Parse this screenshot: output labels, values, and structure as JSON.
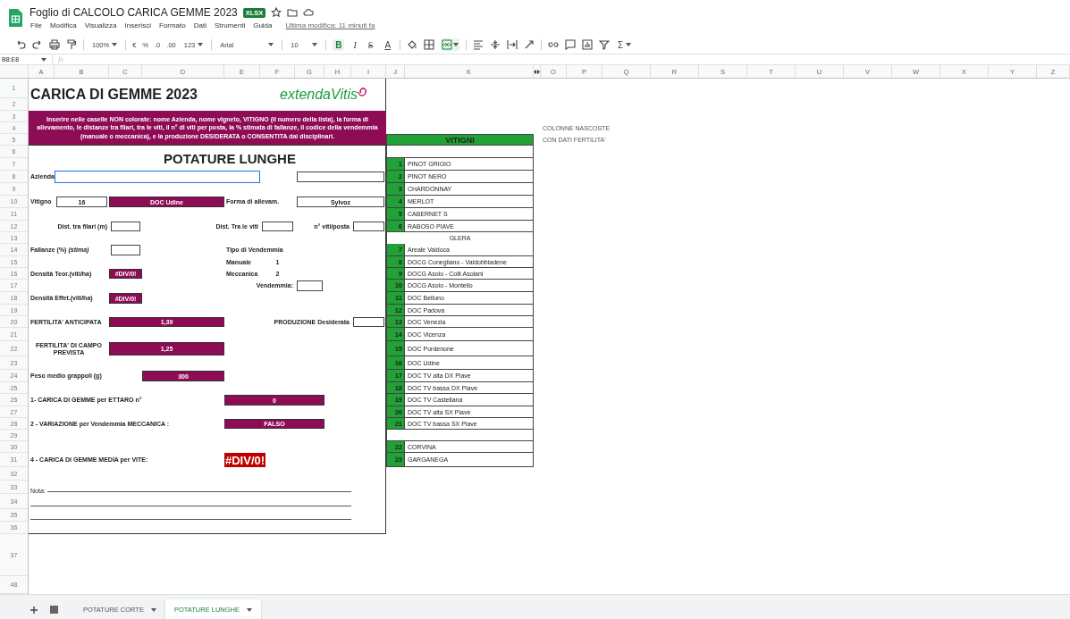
{
  "document": {
    "title": "Foglio di CALCOLO CARICA GEMME 2023",
    "badge": "XLSX",
    "last_edit": "Ultima modifica: 11 minuti fa"
  },
  "menu": [
    "File",
    "Modifica",
    "Visualizza",
    "Inserisci",
    "Formato",
    "Dati",
    "Strumenti",
    "Guida"
  ],
  "toolbar": {
    "zoom": "100%",
    "number_formats": [
      "€",
      "%",
      ".0",
      ".00"
    ],
    "more_formats": "123",
    "font": "Arial",
    "font_size": "10",
    "text_styles": [
      {
        "label": "B",
        "active": true
      },
      {
        "label": "I",
        "active": false
      },
      {
        "label": "S",
        "active": false
      },
      {
        "label": "A",
        "active": false
      }
    ],
    "merge_active": true,
    "function": "Σ"
  },
  "formula_bar": {
    "cell_ref": "B8:E8",
    "fx": "fx"
  },
  "columns": [
    "A",
    "B",
    "C",
    "D",
    "E",
    "F",
    "G",
    "H",
    "I",
    "J",
    "K",
    "O",
    "P",
    "Q",
    "R",
    "S",
    "T",
    "U",
    "V",
    "W",
    "X",
    "Y",
    "Z"
  ],
  "rows": [
    "1",
    "2",
    "3",
    "4",
    "5",
    "6",
    "7",
    "8",
    "9",
    "10",
    "11",
    "12",
    "13",
    "14",
    "15",
    "16",
    "17",
    "18",
    "19",
    "20",
    "21",
    "22",
    "23",
    "24",
    "25",
    "26",
    "27",
    "28",
    "29",
    "30",
    "31",
    "32",
    "33",
    "34",
    "35",
    "36",
    "37",
    "48"
  ],
  "form": [
    {
      "kind": "title",
      "text": "CARICA DI GEMME 2023"
    },
    {
      "kind": "logo",
      "text": "extendaVitis"
    },
    {
      "kind": "banner",
      "text": "Inserire nelle caselle NON colorate: nome Azienda, nome vigneto, VITIGNO (il numero della lista), la forma di allevamento, le distanze tra filari, tra le viti, il n° di viti per posta, la % stimata di fallanze, il codice della vendemmia (manuale o meccanica),  e la produzione DESIDERATA o CONSENTITA dai disciplinari."
    },
    {
      "kind": "heading",
      "text": "POTATURE LUNGHE"
    },
    {
      "kind": "label",
      "text": "Azienda"
    },
    {
      "kind": "input",
      "selected": true
    },
    {
      "kind": "input",
      "selected": false
    },
    {
      "kind": "label",
      "text": "Vitigno"
    },
    {
      "kind": "input",
      "value": "16",
      "selected": false
    },
    {
      "kind": "value",
      "text": "DOC Udine"
    },
    {
      "kind": "label",
      "text": "Forma di allevam."
    },
    {
      "kind": "input",
      "value": "Sylvoz",
      "selected": false
    },
    {
      "kind": "label",
      "text": "Dist. tra filari (m)"
    },
    {
      "kind": "input",
      "selected": false
    },
    {
      "kind": "label",
      "text": "Dist. Tra le viti"
    },
    {
      "kind": "input",
      "selected": false
    },
    {
      "kind": "label",
      "text": "n° viti/posta"
    },
    {
      "kind": "input",
      "selected": false
    },
    {
      "kind": "label",
      "text": "Fallanze (%) *(stima)*"
    },
    {
      "kind": "input",
      "selected": false
    },
    {
      "kind": "label",
      "text": "Tipo di Vendemmia"
    },
    {
      "kind": "label",
      "text": "Manuale"
    },
    {
      "kind": "label",
      "text": "1"
    },
    {
      "kind": "label",
      "text": "Densità Teor.(viti/ha)"
    },
    {
      "kind": "value",
      "text": "#DIV/0!"
    },
    {
      "kind": "label",
      "text": "Meccanica"
    },
    {
      "kind": "label",
      "text": "2"
    },
    {
      "kind": "label",
      "text": "Vendemmia:"
    },
    {
      "kind": "input",
      "selected": false
    },
    {
      "kind": "label",
      "text": "Densità Effet.(viti/ha)"
    },
    {
      "kind": "value",
      "text": "#DIV/0!"
    },
    {
      "kind": "label",
      "text": "FERTILITA' ANTICIPATA"
    },
    {
      "kind": "value",
      "text": "1,39"
    },
    {
      "kind": "label",
      "text": "PRODUZIONE Desiderata"
    },
    {
      "kind": "input",
      "selected": false
    },
    {
      "kind": "label",
      "text": "FERTILITA' DI CAMPO PREVISTA"
    },
    {
      "kind": "value",
      "text": "1,25"
    },
    {
      "kind": "label",
      "text": "Peso medio grappoli (g)"
    },
    {
      "kind": "value",
      "text": "300"
    },
    {
      "kind": "label",
      "text": "1- CARICA DI GEMME  per  ETTARO n°"
    },
    {
      "kind": "value",
      "text": "0"
    },
    {
      "kind": "label",
      "text": "2 - VARIAZIONE per Vendemmia MECCANICA :"
    },
    {
      "kind": "value",
      "text": "FALSO"
    },
    {
      "kind": "label",
      "text": "4 - CARICA DI GEMME MEDIA per VITE:"
    },
    {
      "kind": "error",
      "text": "#DIV/0!"
    },
    {
      "kind": "note",
      "text": "Nota:"
    }
  ],
  "side_note": [
    "COLONNE NASCOSTE",
    "CON DATI FERTILITA'"
  ],
  "vitigni": {
    "title": "VITIGNI",
    "items": [
      {
        "kind": "spacer"
      },
      {
        "kind": "variety",
        "number": "1",
        "name": "PINOT GRIGIO"
      },
      {
        "kind": "variety",
        "number": "2",
        "name": "PINOT NERO"
      },
      {
        "kind": "variety",
        "number": "3",
        "name": "CHARDONNAY"
      },
      {
        "kind": "variety",
        "number": "4",
        "name": "MERLOT"
      },
      {
        "kind": "variety",
        "number": "5",
        "name": "CABERNET S"
      },
      {
        "kind": "variety",
        "number": "6",
        "name": "RABOSO PIAVE"
      },
      {
        "kind": "group",
        "name": "GLERA"
      },
      {
        "kind": "variety",
        "number": "7",
        "name": "Areale Valdoca"
      },
      {
        "kind": "variety",
        "number": "8",
        "name": "DOCG Conegliano - Valdobbiadene"
      },
      {
        "kind": "variety",
        "number": "9",
        "name": "DOCG Asolo - Colli Asolani"
      },
      {
        "kind": "variety",
        "number": "10",
        "name": "DOCG Asolo - Montello"
      },
      {
        "kind": "variety",
        "number": "11",
        "name": "DOC Belluno"
      },
      {
        "kind": "variety",
        "number": "12",
        "name": "DOC Padova"
      },
      {
        "kind": "variety",
        "number": "13",
        "name": "DOC Venezia"
      },
      {
        "kind": "variety",
        "number": "14",
        "name": "DOC Vicenza"
      },
      {
        "kind": "variety",
        "number": "15",
        "name": "DOC Pordenone"
      },
      {
        "kind": "variety",
        "number": "16",
        "name": "DOC Udine"
      },
      {
        "kind": "variety",
        "number": "17",
        "name": "DOC TV alta DX Piave"
      },
      {
        "kind": "variety",
        "number": "18",
        "name": "DOC TV bassa DX Piave"
      },
      {
        "kind": "variety",
        "number": "19",
        "name": "DOC TV Castellana"
      },
      {
        "kind": "variety",
        "number": "20",
        "name": "DOC TV alta SX Piave"
      },
      {
        "kind": "variety",
        "number": "21",
        "name": "DOC TV bassa SX Piave"
      },
      {
        "kind": "spacer"
      },
      {
        "kind": "variety",
        "number": "22",
        "name": "CORVINA"
      },
      {
        "kind": "variety",
        "number": "23",
        "name": "GARGANEGA"
      }
    ]
  },
  "tabs": [
    {
      "label": "POTATURE CORTE",
      "selected": false
    },
    {
      "label": "POTATURE LUNGHE",
      "selected": true
    }
  ]
}
